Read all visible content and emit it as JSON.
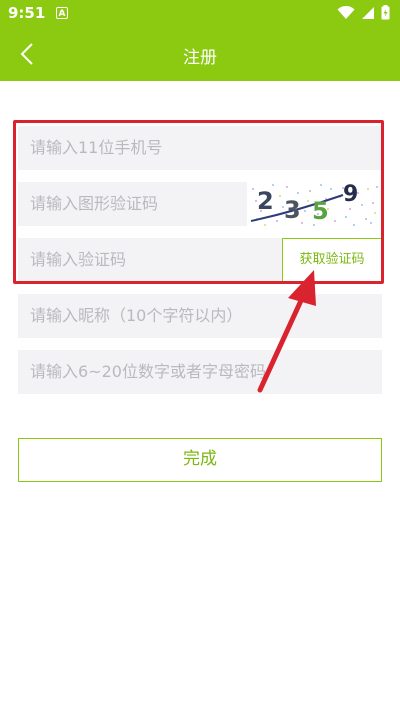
{
  "status_bar": {
    "time": "9:51",
    "app_icon_letter": "A"
  },
  "app_bar": {
    "title": "注册"
  },
  "form": {
    "phone_placeholder": "请输入11位手机号",
    "image_code_placeholder": "请输入图形验证码",
    "captcha_text": "2359",
    "sms_code_placeholder": "请输入验证码",
    "get_code_label": "获取验证码",
    "nickname_placeholder": "请输入昵称（10个字符以内）",
    "password_placeholder": "请输入6~20位数字或者字母密码"
  },
  "submit_label": "完成",
  "colors": {
    "brand": "#8cc911",
    "highlight": "#d9232e",
    "field_bg": "#f3f3f5"
  }
}
